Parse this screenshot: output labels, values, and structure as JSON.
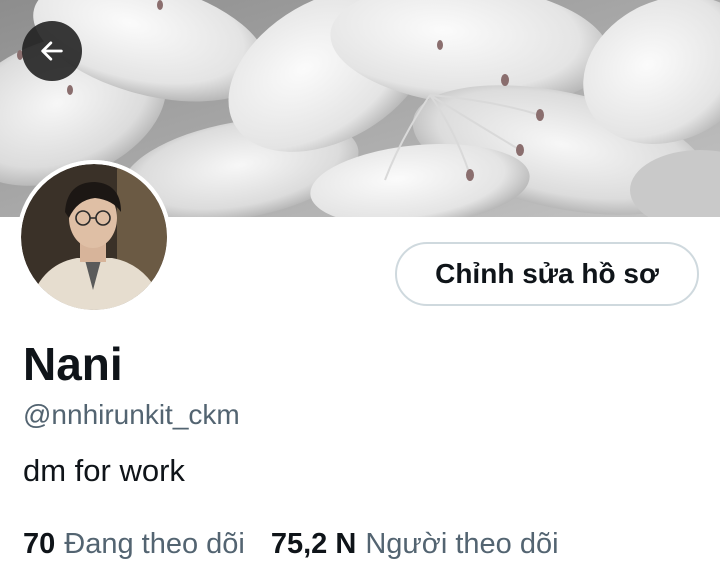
{
  "header": {
    "banner_image": "white-lily-flowers",
    "back_icon": "arrow-left-icon"
  },
  "profile": {
    "avatar_image": "profile-photo",
    "edit_profile_label": "Chỉnh sửa hồ sơ",
    "display_name": "Nani",
    "handle": "@nnhirunkit_ckm",
    "bio": "dm for work"
  },
  "stats": {
    "following_count": "70",
    "following_label": "Đang theo dõi",
    "followers_count": "75,2 N",
    "followers_label": "Người theo dõi"
  },
  "colors": {
    "text_primary": "#0f1419",
    "text_secondary": "#536471",
    "button_border": "#cfd9de",
    "back_button_bg": "#1e1e1e"
  }
}
